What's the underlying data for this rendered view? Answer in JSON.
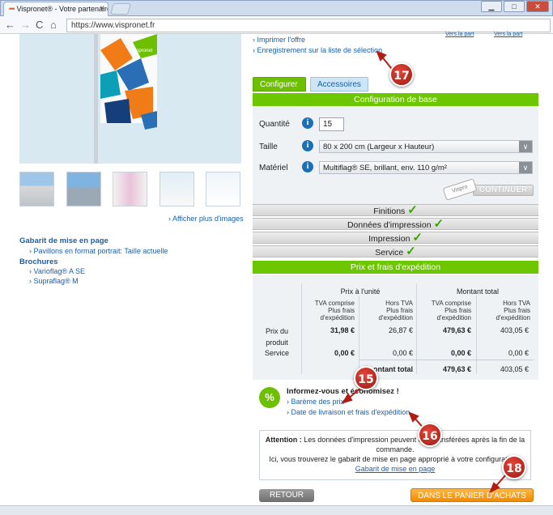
{
  "browser": {
    "tab_title": "Vispronet® - Votre partenaire",
    "tab_close": "×",
    "url": "https://www.vispronet.fr",
    "win_min": "▁",
    "win_max": "□",
    "win_close": "✕",
    "nav_back": "←",
    "nav_forward": "→",
    "nav_reload": "C",
    "nav_home": "⌂"
  },
  "left": {
    "more_images": "› Afficher plus d'images",
    "template_heading": "Gabarit de mise en page",
    "template_link": "› Pavillons en format portrait: Taille actuelle",
    "brochures_heading": "Brochures",
    "brochure_1": "› Varioflag® A SE",
    "brochure_2": "› Supraflag® M",
    "hero_brand": "vispronet"
  },
  "right": {
    "print_offer": "› Imprimer l'offre",
    "save_list": "› Enregistrement sur la liste de sélection",
    "top_link_1": "Vers la part",
    "top_link_2": "Vers la part",
    "tabs": [
      "Configurer",
      "Accessoires"
    ],
    "config_title": "Configuration de base",
    "qty_label": "Quantité",
    "qty_value": "15",
    "size_label": "Taille",
    "size_value": "80 x 200 cm (Largeur x Hauteur)",
    "material_label": "Matériel",
    "material_value": "Multiflag® SE, brillant, env. 110 g/m²",
    "info_glyph": "i",
    "select_arrow": "∨",
    "continue": "CONTINUER",
    "vispro_tag": "Vispro",
    "sections": [
      "Finitions",
      "Données d'impression",
      "Impression",
      "Service"
    ],
    "check_glyph": "✓",
    "price_title": "Prix et frais d'expédition",
    "col_unit": "Prix à l'unité",
    "col_total": "Montant total",
    "sub_ttc": "TVA comprise\nPlus frais\nd'expédition",
    "sub_ht": "Hors TVA\nPlus frais\nd'expédition",
    "row_product": "Prix du\nproduit",
    "row_service": "Service",
    "row_total": "ontant total",
    "product_values": [
      "31,98 €",
      "26,87 €",
      "479,63 €",
      "403,05 €"
    ],
    "service_values": [
      "0,00 €",
      "0,00 €",
      "0,00 €",
      "0,00 €"
    ],
    "total_values": [
      "479,63 €",
      "403,05 €"
    ],
    "promo_glyph": "%",
    "promo_title": "Informez-vous et économisez !",
    "promo_link_1": "› Barème des prix",
    "promo_link_2": "› Date de livraison et frais d'expédition",
    "attention_bold": "Attention :",
    "attention_text": " Les données d'impression peuvent être transférées après la fin de la commande.",
    "attention_line2": "Ici, vous trouverez le gabarit de mise en page approprié à votre configuration :",
    "attention_link": "Gabarit de mise en page",
    "back": "RETOUR",
    "cart": "DANS LE PANIER D'ACHATS"
  },
  "badges": [
    "15",
    "16",
    "17",
    "18"
  ],
  "colors": {
    "green": "#6cc600",
    "link": "#1a5fa8",
    "orange": "#f08a00",
    "badge_red": "#c62a1e"
  }
}
